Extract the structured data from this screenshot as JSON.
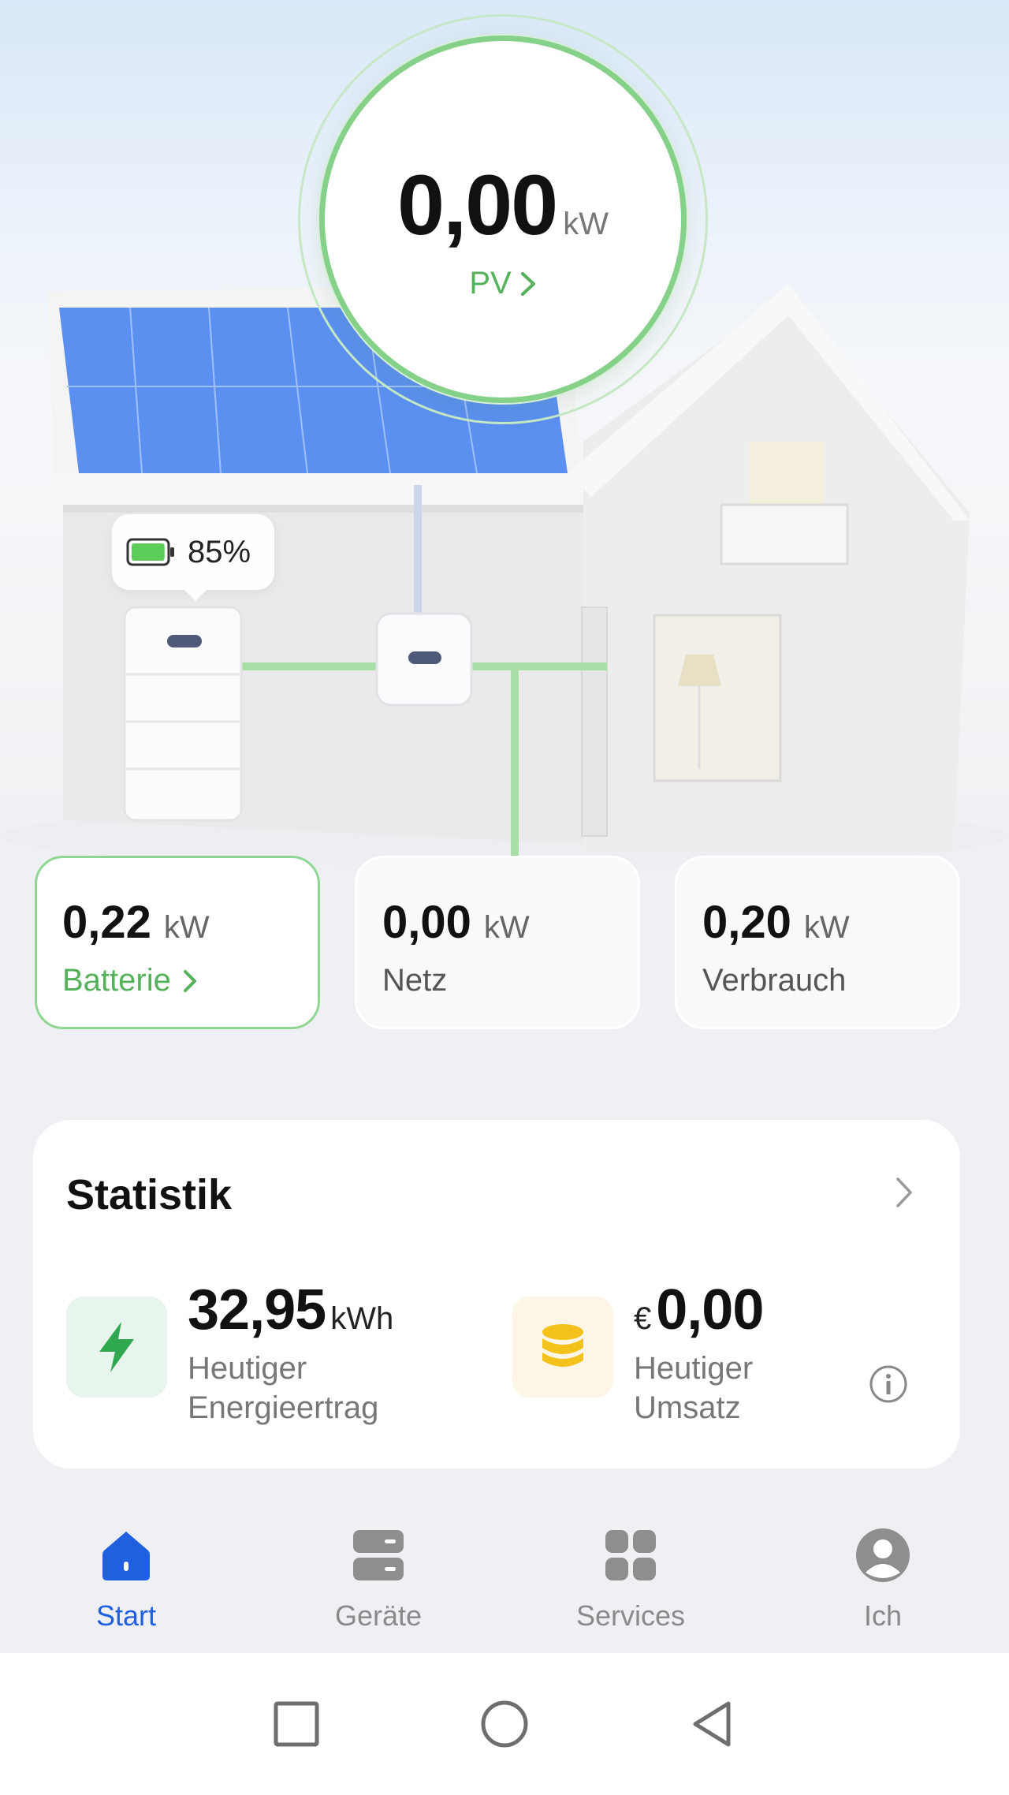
{
  "pv": {
    "value": "0,00",
    "unit": "kW",
    "label": "PV"
  },
  "battery_level": {
    "percent_text": "85%",
    "percent": 85
  },
  "metrics": [
    {
      "value": "0,22",
      "unit": "kW",
      "label": "Batterie"
    },
    {
      "value": "0,00",
      "unit": "kW",
      "label": "Netz"
    },
    {
      "value": "0,20",
      "unit": "kW",
      "label": "Verbrauch"
    }
  ],
  "statistics": {
    "title": "Statistik",
    "energy": {
      "value": "32,95",
      "unit": "kWh",
      "label_line1": "Heutiger",
      "label_line2": "Energieertrag",
      "icon": "lightning-icon"
    },
    "revenue": {
      "currency": "€",
      "value": "0,00",
      "label_line1": "Heutiger",
      "label_line2": "Umsatz",
      "icon": "coins-icon"
    }
  },
  "nav": [
    {
      "label": "Start",
      "icon": "home-icon",
      "active": true
    },
    {
      "label": "Geräte",
      "icon": "devices-icon",
      "active": false
    },
    {
      "label": "Services",
      "icon": "grid-icon",
      "active": false
    },
    {
      "label": "Ich",
      "icon": "profile-icon",
      "active": false
    }
  ],
  "colors": {
    "accent_green": "#56b15b",
    "nav_active": "#1f5fe0",
    "energy_icon": "#2fa84f",
    "coin_icon": "#f5c21b"
  }
}
